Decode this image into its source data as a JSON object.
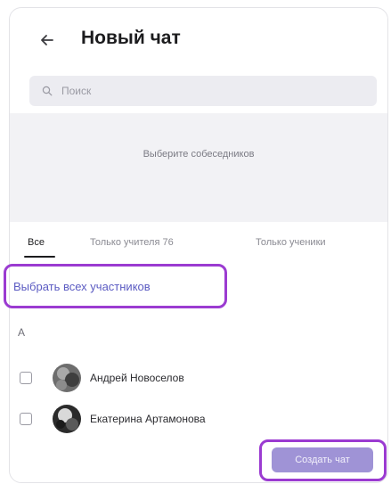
{
  "header": {
    "title": "Новый чат",
    "back_icon": "arrow-left-icon"
  },
  "search": {
    "placeholder": "Поиск",
    "icon": "search-icon"
  },
  "empty_state": {
    "hint": "Выберите собеседников"
  },
  "tabs": [
    {
      "label": "Все",
      "active": true
    },
    {
      "label": "Только учителя 76",
      "active": false
    },
    {
      "label": "Только ученики",
      "active": false
    }
  ],
  "select_all": {
    "label": "Выбрать всех участников"
  },
  "list": {
    "section_letter": "А",
    "contacts": [
      {
        "name": "Андрей Новоселов",
        "checked": false
      },
      {
        "name": "Екатерина Артамонова",
        "checked": false
      }
    ]
  },
  "footer": {
    "create_label": "Создать чат"
  },
  "colors": {
    "highlight_border": "#9b3bd1",
    "link": "#5b5bc2",
    "button_bg": "#9f93d6",
    "search_bg": "#ececf1"
  }
}
